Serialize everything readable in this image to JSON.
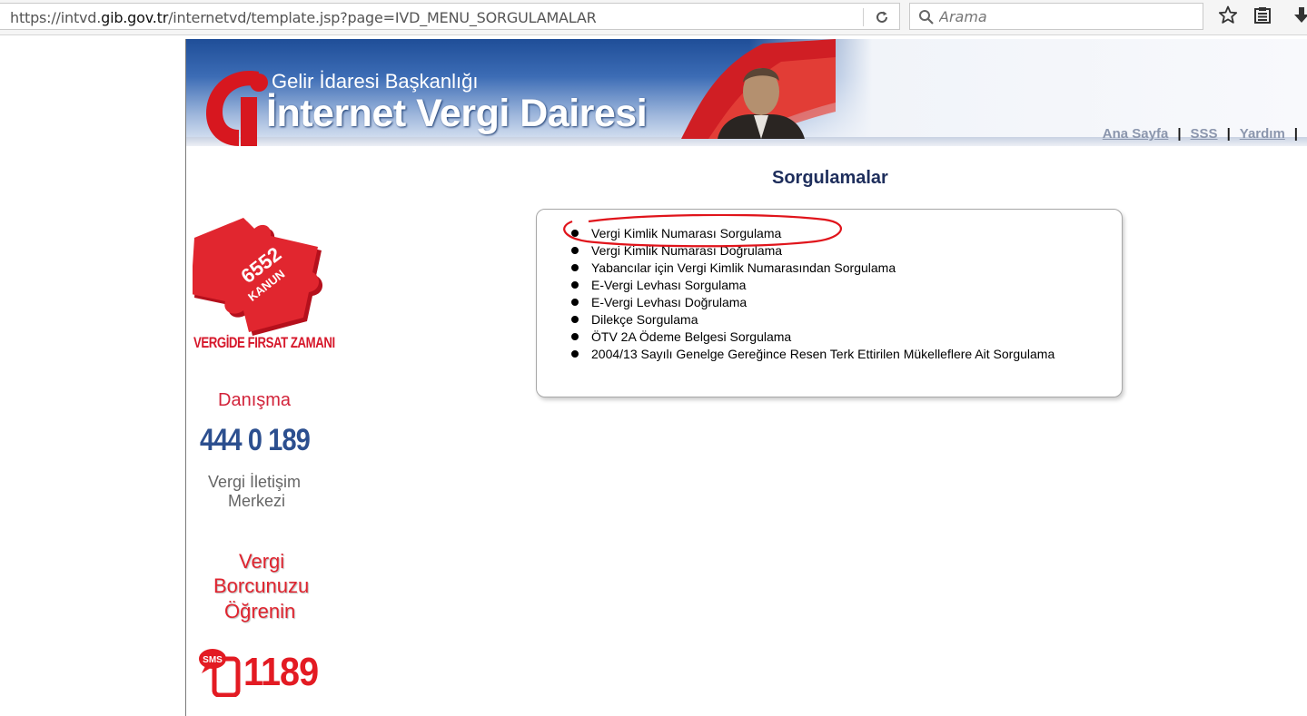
{
  "browser": {
    "url_prefix": "https://intvd.",
    "url_domain": "gib.gov.tr",
    "url_suffix": "/internetvd/template.jsp?page=IVD_MENU_SORGULAMALAR",
    "search_placeholder": "Arama"
  },
  "header": {
    "org_name": "Gelir İdaresi Başkanlığı",
    "site_title": "İnternet Vergi Dairesi",
    "links": [
      "Ana Sayfa",
      "SSS",
      "Yardım"
    ],
    "separator": "|"
  },
  "sidebar": {
    "campaign_badge_number": "6552",
    "campaign_badge_word": "KANUN",
    "campaign_caption": "VERGİDE FIRSAT ZAMANI",
    "help_label": "Danışma",
    "help_phone": "444 0 189",
    "help_center_line1": "Vergi İletişim",
    "help_center_line2": "Merkezi",
    "debt_line1": "Vergi",
    "debt_line2": "Borcunuzu",
    "debt_line3": "Öğrenin",
    "sms_badge": "SMS",
    "sms_number": "1189"
  },
  "main": {
    "title": "Sorgulamalar",
    "queries": [
      "Vergi Kimlik Numarası Sorgulama",
      "Vergi Kimlik Numarası Doğrulama",
      "Yabancılar için Vergi Kimlik Numarasından Sorgulama",
      "E-Vergi Levhası Sorgulama",
      "E-Vergi Levhası Doğrulama",
      "Dilekçe Sorgulama",
      "ÖTV 2A Ödeme Belgesi Sorgulama",
      "2004/13 Sayılı Genelge Gereğince Resen Terk Ettirilen Mükelleflere Ait Sorgulama"
    ]
  },
  "colors": {
    "banner_blue": "#1f4e98",
    "title_navy": "#1e2e5c",
    "brand_red": "#e31b23",
    "annotation_red": "#e0141b",
    "phone_blue": "#2c4f8f"
  }
}
